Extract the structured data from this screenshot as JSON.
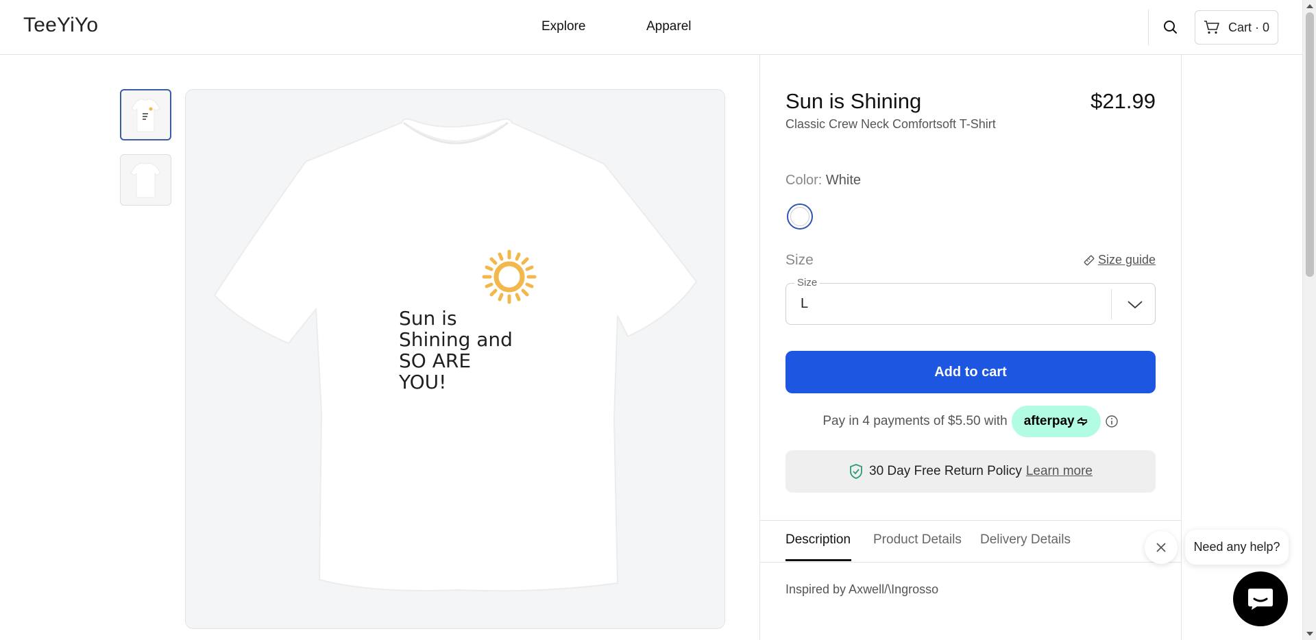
{
  "header": {
    "logo": "TeeYiYo",
    "nav": [
      "Explore",
      "Apparel"
    ],
    "cart_label": "Cart · 0"
  },
  "icons": {
    "search": "search-icon",
    "cart": "cart-icon",
    "ruler": "ruler-icon",
    "chevron": "chevron-down-icon",
    "info": "info-icon",
    "shield": "shield-check-icon",
    "close": "close-icon",
    "chat": "chat-icon"
  },
  "gallery": {
    "print_text": "Sun is\nShining and\nSO ARE\nYOU!",
    "selected_thumbnail": 1
  },
  "product": {
    "title": "Sun is Shining",
    "price": "$21.99",
    "subtitle": "Classic Crew Neck Comfortsoft T-Shirt",
    "color_label": "Color:",
    "color_value": "White",
    "size_label": "Size",
    "size_guide": "Size guide",
    "size_field_label": "Size",
    "size_value": "L",
    "add_to_cart": "Add to cart",
    "afterpay_text": "Pay in 4 payments of $5.50 with",
    "afterpay_brand": "afterpay",
    "return_policy": "30 Day Free Return Policy",
    "learn_more": "Learn more"
  },
  "tabs": [
    {
      "label": "Description",
      "active": true
    },
    {
      "label": "Product Details",
      "active": false
    },
    {
      "label": "Delivery Details",
      "active": false
    }
  ],
  "description": "Inspired by Axwell/\\Ingrosso",
  "chat": {
    "bubble": "Need any help?"
  },
  "colors": {
    "accent": "#1c56e1",
    "afterpay_mint": "#b2fce4",
    "sun_yellow": "#f2b84b",
    "shield_green": "#2a9d6f"
  }
}
